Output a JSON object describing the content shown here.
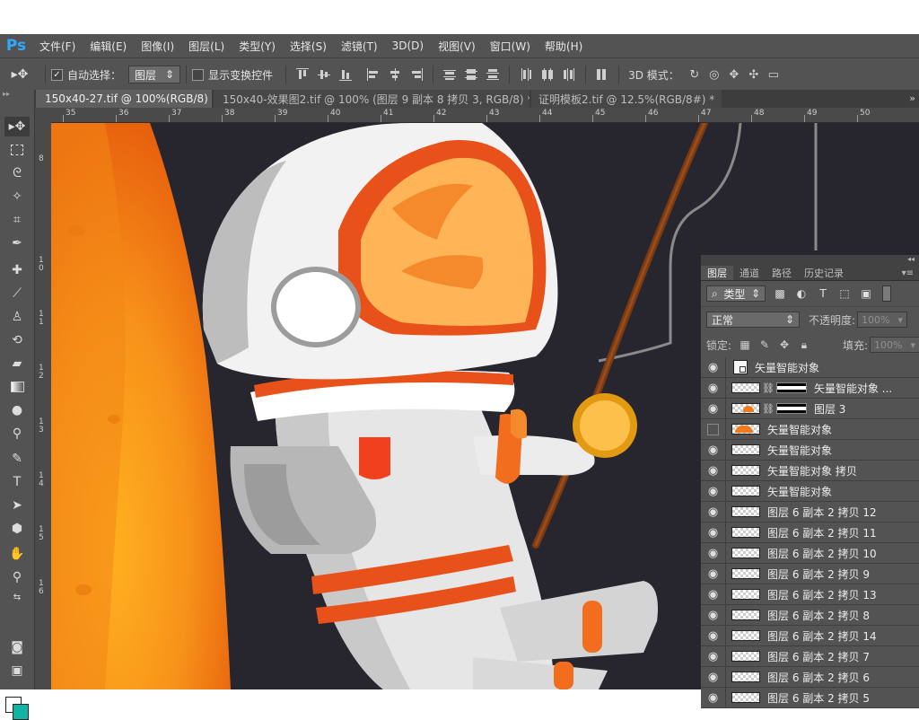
{
  "app": {
    "logo": "Ps"
  },
  "menu": [
    "文件(F)",
    "编辑(E)",
    "图像(I)",
    "图层(L)",
    "类型(Y)",
    "选择(S)",
    "滤镜(T)",
    "3D(D)",
    "视图(V)",
    "窗口(W)",
    "帮助(H)"
  ],
  "options": {
    "auto_select_label": "自动选择：",
    "auto_select_checked": true,
    "auto_select_target": "图层",
    "show_transform_label": "显示变换控件",
    "show_transform_checked": false,
    "mode_label": "3D 模式："
  },
  "tabs": [
    {
      "label": "150x40-27.tif @ 100%(RGB/8)",
      "active": true
    },
    {
      "label": "150x40-效果图2.tif @ 100% (图层 9 副本 8 拷贝 3, RGB/8) *",
      "active": false
    },
    {
      "label": "证明模板2.tif @ 12.5%(RGB/8#) *",
      "active": false
    }
  ],
  "ruler": {
    "top": [
      "35",
      "36",
      "37",
      "38",
      "39",
      "40",
      "41",
      "42",
      "43",
      "44",
      "45",
      "46",
      "47",
      "48",
      "49",
      "50"
    ],
    "left": [
      "8",
      "1 0",
      "1 1",
      "1 2",
      "1 3",
      "1 4",
      "1 5",
      "1 6"
    ]
  },
  "colors": {
    "foreground": "#ffffff",
    "background": "#12b5a3",
    "canvas": "#27262f",
    "planet": "#f47a12",
    "accent": "#e8521a"
  },
  "layers_panel": {
    "tabs": [
      "图层",
      "通道",
      "路径",
      "历史记录"
    ],
    "filter_kind": "类型",
    "blend_mode": "正常",
    "opacity_label": "不透明度:",
    "opacity_value": "100%",
    "lock_label": "锁定:",
    "fill_label": "填充:",
    "fill_value": "100%",
    "layers": [
      {
        "name": "矢量智能对象",
        "visible": true,
        "thumb": "smart"
      },
      {
        "name": "矢量智能对象 ...",
        "visible": true,
        "thumb": "mask-checker"
      },
      {
        "name": "图层 3",
        "visible": true,
        "thumb": "mask-orange"
      },
      {
        "name": "矢量智能对象",
        "visible": false,
        "thumb": "orange"
      },
      {
        "name": "矢量智能对象",
        "visible": true,
        "thumb": "checker"
      },
      {
        "name": "矢量智能对象 拷贝",
        "visible": true,
        "thumb": "checker"
      },
      {
        "name": "矢量智能对象",
        "visible": true,
        "thumb": "checker"
      },
      {
        "name": "图层 6 副本 2 拷贝 12",
        "visible": true,
        "thumb": "checker"
      },
      {
        "name": "图层 6 副本 2 拷贝 11",
        "visible": true,
        "thumb": "checker"
      },
      {
        "name": "图层 6 副本 2 拷贝 10",
        "visible": true,
        "thumb": "checker"
      },
      {
        "name": "图层 6 副本 2 拷贝 9",
        "visible": true,
        "thumb": "checker"
      },
      {
        "name": "图层 6 副本 2 拷贝 13",
        "visible": true,
        "thumb": "checker"
      },
      {
        "name": "图层 6 副本 2 拷贝 8",
        "visible": true,
        "thumb": "checker"
      },
      {
        "name": "图层 6 副本 2 拷贝 14",
        "visible": true,
        "thumb": "checker"
      },
      {
        "name": "图层 6 副本 2 拷贝 7",
        "visible": true,
        "thumb": "checker"
      },
      {
        "name": "图层 6 副本 2 拷贝 6",
        "visible": true,
        "thumb": "checker"
      },
      {
        "name": "图层 6 副本 2 拷贝 5",
        "visible": true,
        "thumb": "checker"
      }
    ]
  }
}
